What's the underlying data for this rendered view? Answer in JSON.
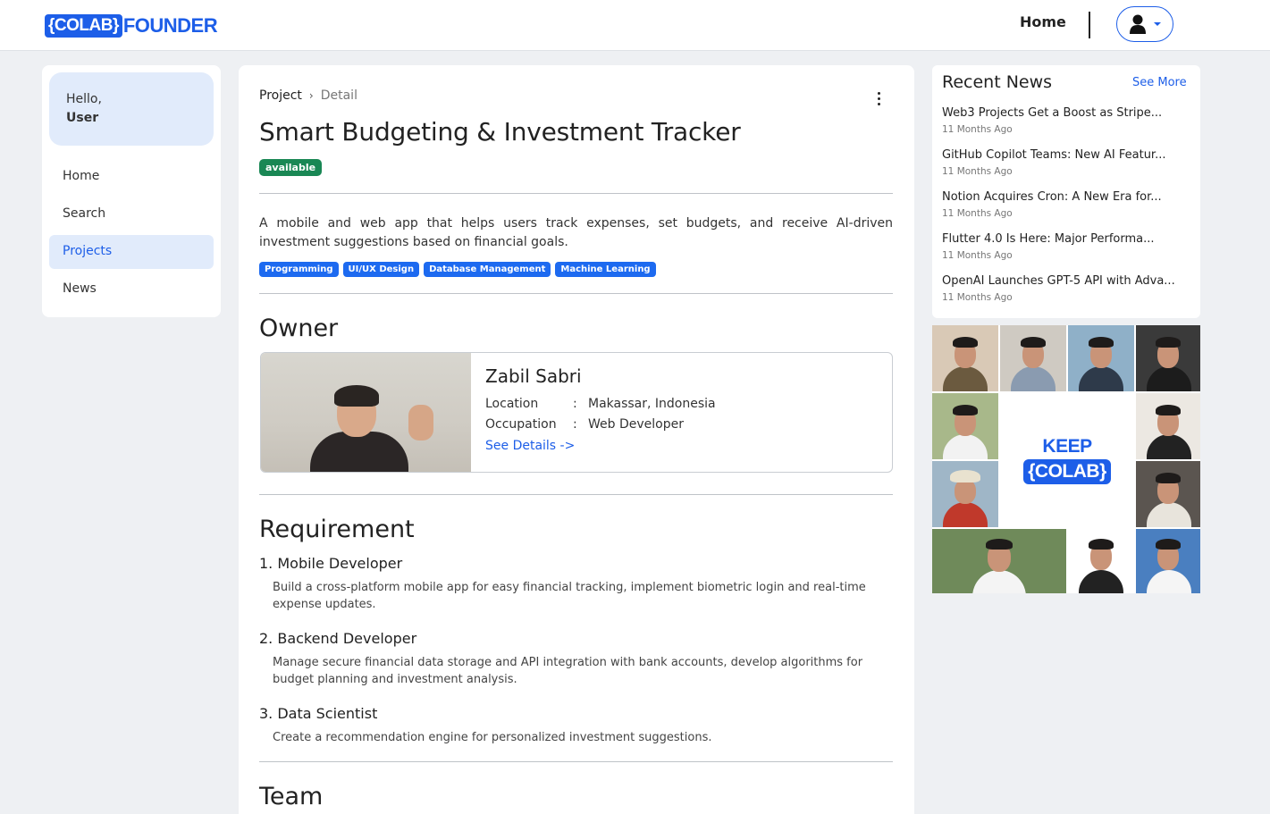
{
  "brand": {
    "logo_box": "{COLAB}",
    "logo_word": "FOUNDER",
    "accent": "#1d5ee8"
  },
  "navbar": {
    "home_label": "Home",
    "profile_icon": "user-icon"
  },
  "sidebar": {
    "greeting": "Hello,",
    "user": "User",
    "items": [
      {
        "label": "Home",
        "active": false
      },
      {
        "label": "Search",
        "active": false
      },
      {
        "label": "Projects",
        "active": true
      },
      {
        "label": "News",
        "active": false
      }
    ]
  },
  "project": {
    "breadcrumb": {
      "root": "Project",
      "current": "Detail"
    },
    "title": "Smart Budgeting & Investment Tracker",
    "status": "available",
    "status_color": "#198754",
    "description": "A mobile and web app that helps users track expenses, set budgets, and receive AI-driven investment suggestions based on financial goals.",
    "tags": [
      "Programming",
      "UI/UX Design",
      "Database Management",
      "Machine Learning"
    ],
    "tag_color": "#1d6af0"
  },
  "owner": {
    "heading": "Owner",
    "name": "Zabil Sabri",
    "location_label": "Location",
    "location": "Makassar, Indonesia",
    "occupation_label": "Occupation",
    "occupation": "Web Developer",
    "separator": ":",
    "see_details": "See Details ->"
  },
  "requirement": {
    "heading": "Requirement",
    "items": [
      {
        "title": "1. Mobile Developer",
        "desc": "Build a cross-platform mobile app for easy financial tracking, implement biometric login and real-time expense updates."
      },
      {
        "title": "2. Backend Developer",
        "desc": "Manage secure financial data storage and API integration with bank accounts, develop algorithms for budget planning and investment analysis."
      },
      {
        "title": "3. Data Scientist",
        "desc": "Create a recommendation engine for personalized investment suggestions."
      }
    ]
  },
  "team": {
    "heading": "Team"
  },
  "news": {
    "heading": "Recent News",
    "see_more": "See More",
    "items": [
      {
        "title": "Web3 Projects Get a Boost as Stripe...",
        "date": "11 Months Ago"
      },
      {
        "title": "GitHub Copilot Teams: New AI Featur...",
        "date": "11 Months Ago"
      },
      {
        "title": "Notion Acquires Cron: A New Era for...",
        "date": "11 Months Ago"
      },
      {
        "title": "Flutter 4.0 Is Here: Major Performa...",
        "date": "11 Months Ago"
      },
      {
        "title": "OpenAI Launches GPT-5 API with Adva...",
        "date": "11 Months Ago"
      }
    ]
  },
  "banner": {
    "keep": "KEEP",
    "colab": "{COLAB}"
  }
}
